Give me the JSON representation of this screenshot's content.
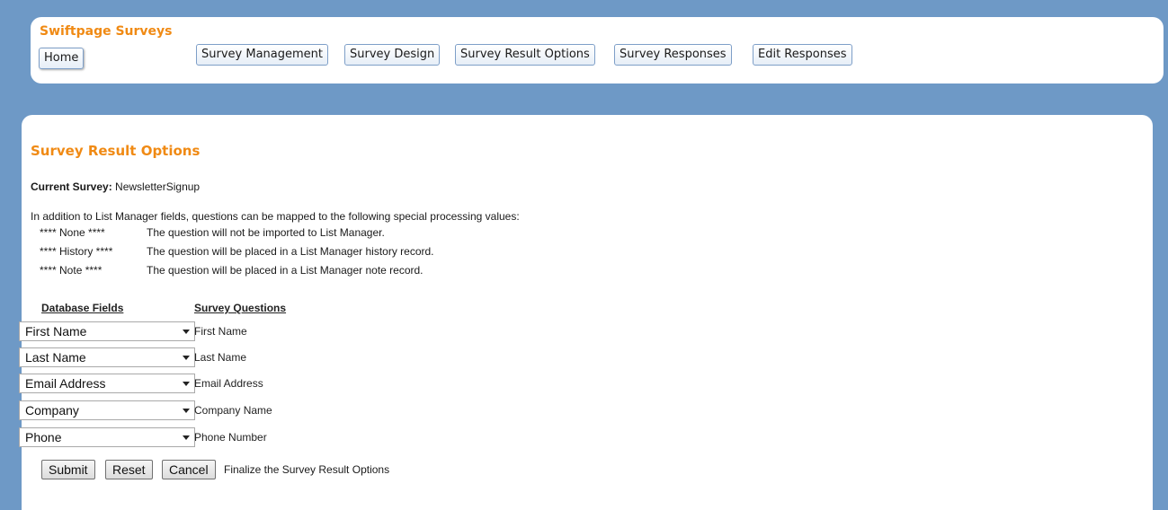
{
  "header": {
    "brand": "Swiftpage Surveys",
    "home_label": "Home",
    "nav": [
      "Survey Management",
      "Survey Design",
      "Survey Result Options",
      "Survey Responses",
      "Edit Responses"
    ]
  },
  "main": {
    "title": "Survey Result Options",
    "current_survey_label": "Current Survey:",
    "current_survey_value": "NewsletterSignup",
    "intro": "In addition to List Manager fields, questions can be mapped to the following special processing values:",
    "special": [
      {
        "key": "**** None ****",
        "desc": "The question will not be imported to List Manager."
      },
      {
        "key": "**** History ****",
        "desc": "The question will be placed in a List Manager history record."
      },
      {
        "key": "**** Note ****",
        "desc": "The question will be placed in a List Manager note record."
      }
    ],
    "col_db": "Database Fields",
    "col_q": "Survey Questions",
    "mappings": [
      {
        "field": "First Name",
        "question": "First Name"
      },
      {
        "field": "Last Name",
        "question": "Last Name"
      },
      {
        "field": "Email Address",
        "question": "Email Address"
      },
      {
        "field": "Company",
        "question": "Company Name"
      },
      {
        "field": "Phone",
        "question": "Phone Number"
      }
    ],
    "buttons": {
      "submit": "Submit",
      "reset": "Reset",
      "cancel": "Cancel"
    },
    "finalize_text": "Finalize the Survey Result Options"
  }
}
